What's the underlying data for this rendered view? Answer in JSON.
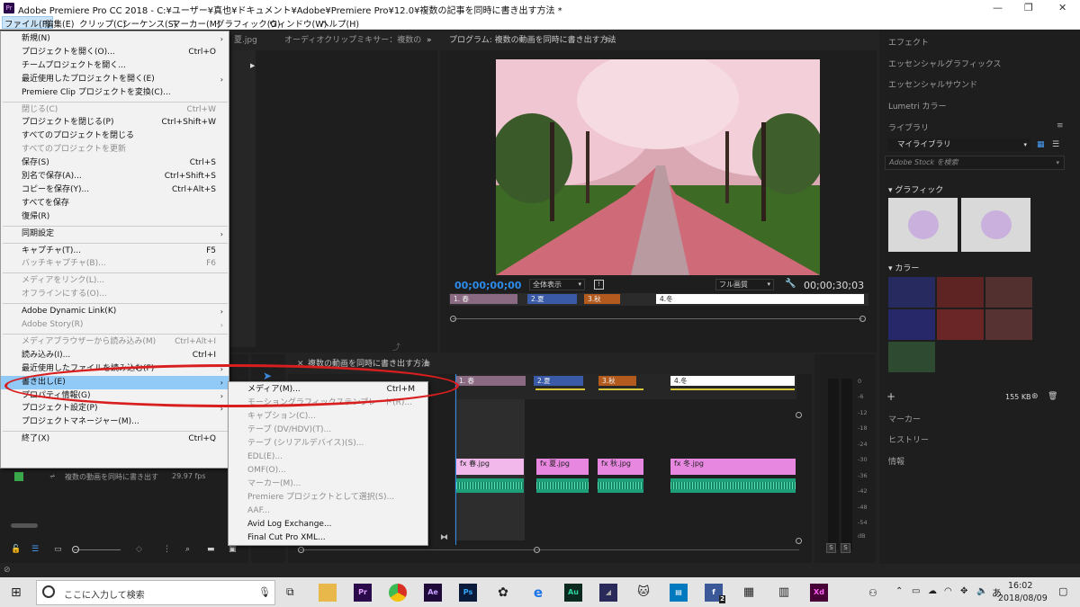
{
  "window": {
    "title": "Adobe Premiere Pro CC 2018 - C:¥ユーザー¥真也¥ドキュメント¥Adobe¥Premiere Pro¥12.0¥複数の記事を同時に書き出す方法 *",
    "app_icon": "Pr",
    "minimize": "—",
    "maximize": "❐",
    "close": "✕"
  },
  "menubar": [
    "ファイル(F)",
    "編集(E)",
    "クリップ(C)",
    "シーケンス(S)",
    "マーカー(M)",
    "グラフィック(G)",
    "ウィンドウ(W)",
    "ヘルプ(H)"
  ],
  "file_menu": [
    {
      "label": "新規(N)",
      "submenu": true
    },
    {
      "label": "プロジェクトを開く(O)...",
      "shortcut": "Ctrl+O"
    },
    {
      "label": "チームプロジェクトを開く..."
    },
    {
      "label": "最近使用したプロジェクトを開く(E)",
      "submenu": true
    },
    {
      "label": "Premiere Clip プロジェクトを変換(C)..."
    },
    {
      "sep": true
    },
    {
      "label": "閉じる(C)",
      "shortcut": "Ctrl+W",
      "disabled": true
    },
    {
      "label": "プロジェクトを閉じる(P)",
      "shortcut": "Ctrl+Shift+W"
    },
    {
      "label": "すべてのプロジェクトを閉じる"
    },
    {
      "label": "すべてのプロジェクトを更新",
      "disabled": true
    },
    {
      "label": "保存(S)",
      "shortcut": "Ctrl+S"
    },
    {
      "label": "別名で保存(A)...",
      "shortcut": "Ctrl+Shift+S"
    },
    {
      "label": "コピーを保存(Y)...",
      "shortcut": "Ctrl+Alt+S"
    },
    {
      "label": "すべてを保存"
    },
    {
      "label": "復帰(R)"
    },
    {
      "sep": true
    },
    {
      "label": "同期設定",
      "submenu": true
    },
    {
      "sep": true
    },
    {
      "label": "キャプチャ(T)...",
      "shortcut": "F5"
    },
    {
      "label": "バッチキャプチャ(B)...",
      "shortcut": "F6",
      "disabled": true
    },
    {
      "sep": true
    },
    {
      "label": "メディアをリンク(L)...",
      "disabled": true
    },
    {
      "label": "オフラインにする(O)...",
      "disabled": true
    },
    {
      "sep": true
    },
    {
      "label": "Adobe Dynamic Link(K)",
      "submenu": true
    },
    {
      "label": "Adobe Story(R)",
      "submenu": true,
      "disabled": true
    },
    {
      "sep": true
    },
    {
      "label": "メディアブラウザーから読み込み(M)",
      "shortcut": "Ctrl+Alt+I",
      "disabled": true
    },
    {
      "label": "読み込み(I)...",
      "shortcut": "Ctrl+I"
    },
    {
      "label": "最近使用したファイルを読み込む(F)",
      "submenu": true
    },
    {
      "label": "書き出し(E)",
      "submenu": true,
      "highlighted": true
    },
    {
      "label": "プロパティ情報(G)",
      "submenu": true
    },
    {
      "label": "プロジェクト設定(P)",
      "submenu": true
    },
    {
      "label": "プロジェクトマネージャー(M)..."
    },
    {
      "sep": true
    },
    {
      "label": "終了(X)",
      "shortcut": "Ctrl+Q"
    }
  ],
  "export_submenu": [
    {
      "label": "メディア(M)...",
      "shortcut": "Ctrl+M"
    },
    {
      "label": "モーショングラフィックステンプレート(R)...",
      "disabled": true
    },
    {
      "label": "キャプション(C)...",
      "disabled": true
    },
    {
      "label": "テープ (DV/HDV)(T)...",
      "disabled": true
    },
    {
      "label": "テープ (シリアルデバイス)(S)...",
      "disabled": true
    },
    {
      "label": "EDL(E)...",
      "disabled": true
    },
    {
      "label": "OMF(O)...",
      "disabled": true
    },
    {
      "label": "マーカー(M)...",
      "disabled": true
    },
    {
      "label": "Premiere プロジェクトとして選択(S)...",
      "disabled": true
    },
    {
      "label": "AAF...",
      "disabled": true
    },
    {
      "label": "Avid Log Exchange..."
    },
    {
      "label": "Final Cut Pro XML..."
    }
  ],
  "source_panel": {
    "tab1": "夏.jpg",
    "tab2": "オーディオクリップミキサー：複数の",
    "expand": "»"
  },
  "program_monitor": {
    "title": "プログラム: 複数の動画を同時に書き出す方法",
    "timecode_in": "00;00;00;00",
    "timecode_out": "00;00;30;03",
    "zoom": "全体表示",
    "quality": "フル画質",
    "markers": [
      "1. 春",
      "2.夏",
      "3.秋",
      "4.冬"
    ]
  },
  "timeline": {
    "title": "複数の動画を同時に書き出す方法",
    "markers": [
      "1. 春",
      "2.夏",
      "3.秋",
      "4.冬"
    ],
    "clips": [
      "春.jpg",
      "夏.jpg",
      "秋.jpg",
      "冬.jpg"
    ]
  },
  "project_panel": {
    "sequence": "複数の動画を同時に書き出す",
    "fps": "29.97 fps"
  },
  "meter": {
    "ticks": [
      "0",
      "-6",
      "-12",
      "-18",
      "-24",
      "-30",
      "-36",
      "-42",
      "-48",
      "-54",
      "dB"
    ],
    "solo": [
      "S",
      "S"
    ]
  },
  "right_panels": {
    "effects": "エフェクト",
    "essential_graphics": "エッセンシャルグラフィックス",
    "essential_sound": "エッセンシャルサウンド",
    "lumetri": "Lumetri カラー",
    "libraries": "ライブラリ",
    "my_library": "マイライブラリ",
    "stock_search": "Adobe Stock を検索",
    "graphics_section": "グラフィック",
    "colors_section": "カラー",
    "size": "155 KB",
    "markers": "マーカー",
    "history": "ヒストリー",
    "info": "情報",
    "swatches": [
      "#262a5e",
      "#5e2424",
      "#523030",
      "#26286a",
      "#6a2626",
      "#563232",
      "#2e4a30"
    ]
  },
  "taskbar": {
    "search_placeholder": "ここに入力して検索",
    "time": "16:02",
    "date": "2018/08/09",
    "ime": "あ",
    "apps": [
      "Pr",
      "Ae",
      "Ps",
      "Au",
      "Xd"
    ],
    "fb_badge": "2"
  }
}
